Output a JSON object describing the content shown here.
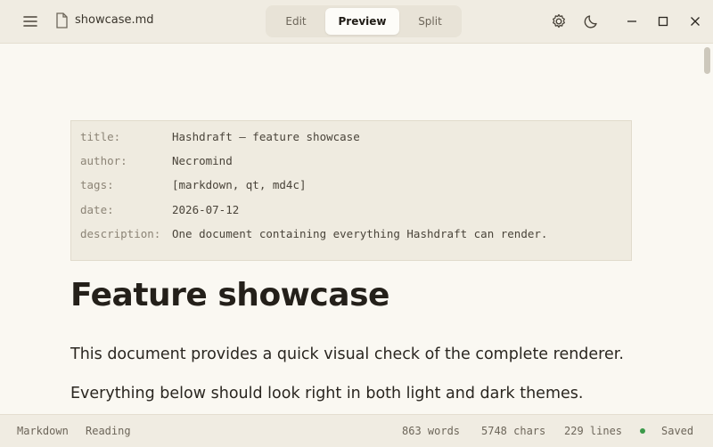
{
  "titlebar": {
    "filename": "showcase.md",
    "tabs": [
      {
        "label": "Edit",
        "active": false
      },
      {
        "label": "Preview",
        "active": true
      },
      {
        "label": "Split",
        "active": false
      }
    ],
    "icons": [
      "menu-icon",
      "file-icon",
      "gear-icon",
      "moon-icon",
      "minimize-icon",
      "maximize-icon",
      "close-icon"
    ]
  },
  "frontmatter": [
    {
      "key": "title:",
      "value": "Hashdraft — feature showcase"
    },
    {
      "key": "author:",
      "value": "Necromind"
    },
    {
      "key": "tags:",
      "value": "[markdown, qt, md4c]"
    },
    {
      "key": "date:",
      "value": "2026-07-12"
    },
    {
      "key": "description:",
      "value": "One document containing everything Hashdraft can render."
    }
  ],
  "document": {
    "heading": "Feature showcase",
    "paragraphs": [
      "This document provides a quick visual check of the complete renderer.",
      "Everything below should look right in both light and dark themes."
    ]
  },
  "statusbar": {
    "mode": "Markdown",
    "state": "Reading",
    "words": "863 words",
    "chars": "5748 chars",
    "lines": "229 lines",
    "saved": "Saved",
    "saved_color": "#3c9a4a"
  },
  "colors": {
    "background": "#faf8f2",
    "chrome": "#f0ece2",
    "frontmatter_bg": "#efebe0"
  }
}
